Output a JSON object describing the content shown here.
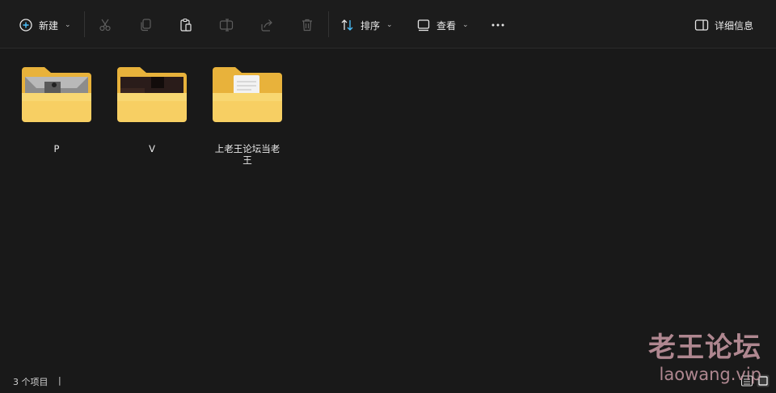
{
  "toolbar": {
    "new_label": "新建",
    "sort_label": "排序",
    "view_label": "查看",
    "details_label": "详细信息"
  },
  "items": [
    {
      "name": "P",
      "preview": "photo-gray"
    },
    {
      "name": "V",
      "preview": "photo-dark"
    },
    {
      "name": "上老王论坛当老王",
      "preview": "document"
    }
  ],
  "status": {
    "item_count": "3 个项目",
    "separator": "|"
  },
  "watermark": {
    "title": "老王论坛",
    "domain": "laowang.vip"
  },
  "colors": {
    "background": "#191919",
    "folder_back": "#e8b23b",
    "folder_front": "#f8d772",
    "accent": "#4cc2ff"
  }
}
